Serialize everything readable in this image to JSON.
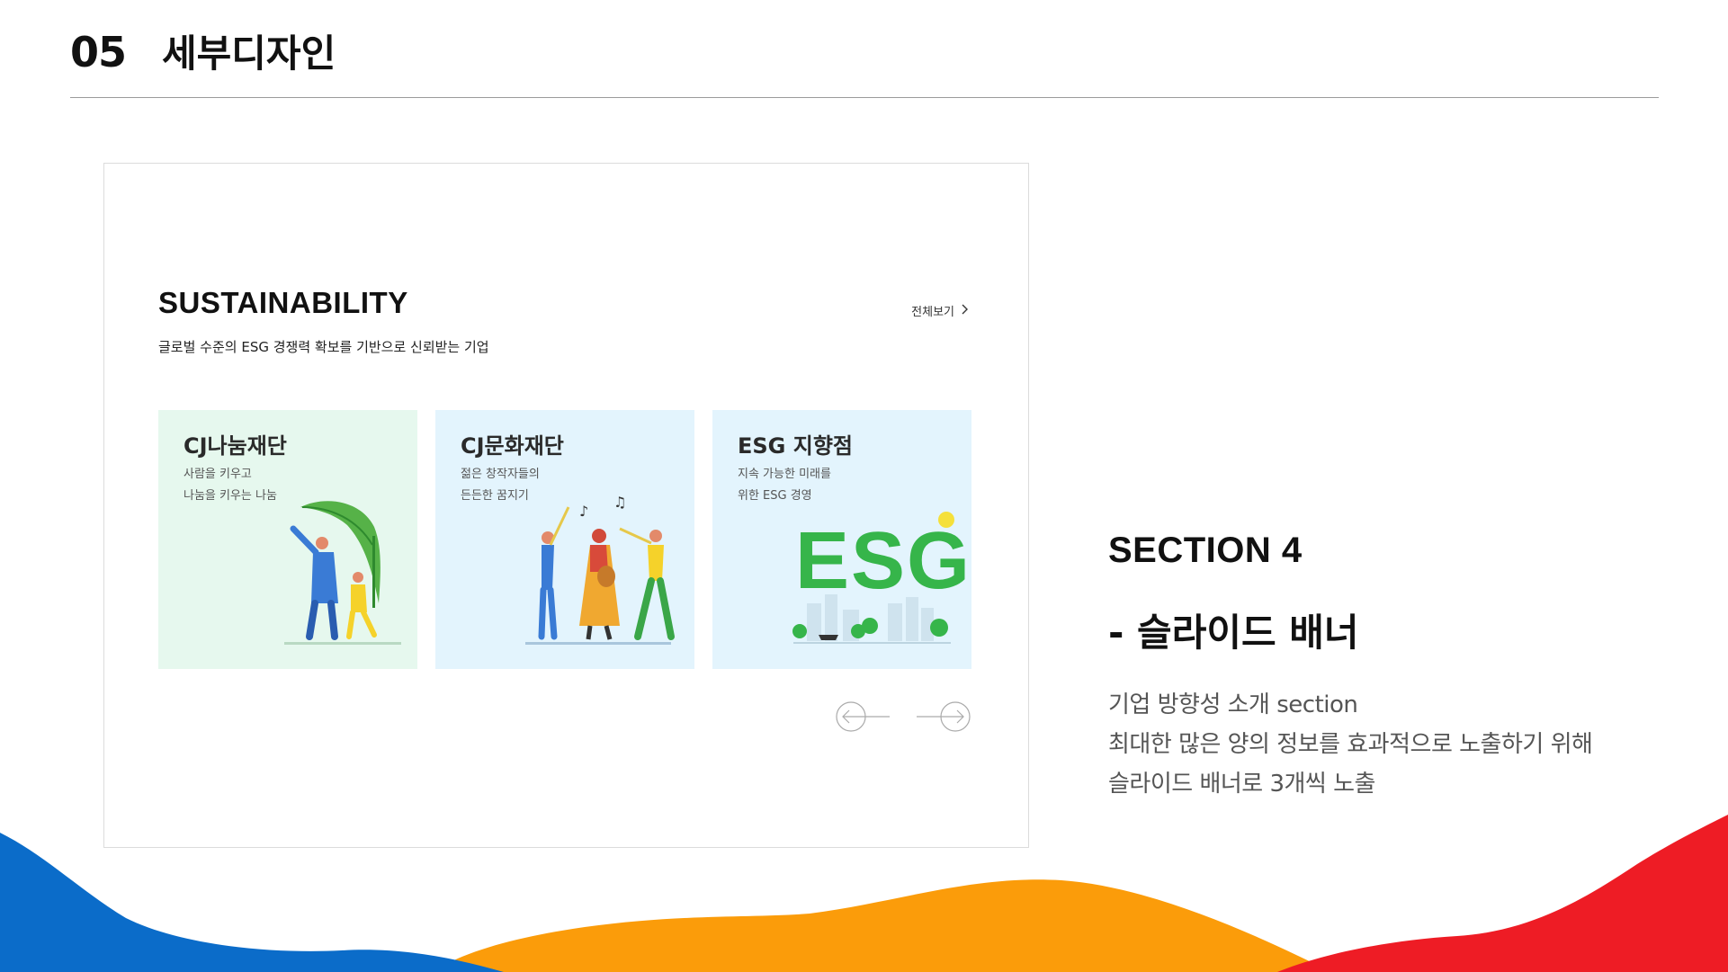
{
  "header": {
    "number": "05",
    "title": "세부디자인"
  },
  "mockup": {
    "title": "SUSTAINABILITY",
    "subtitle": "글로벌 수준의 ESG 경쟁력 확보를 기반으로 신뢰받는 기업",
    "see_all": "전체보기",
    "cards": [
      {
        "title": "CJ나눔재단",
        "desc1": "사람을 키우고",
        "desc2": "나눔을 키우는 나눔",
        "bg": "#e6f8ee"
      },
      {
        "title": "CJ문화재단",
        "desc1": "젊은 창작자들의",
        "desc2": "든든한 꿈지기",
        "bg": "#e3f4fd"
      },
      {
        "title": "ESG 지향점",
        "desc1": "지속 가능한 미래를",
        "desc2": "위한 ESG 경영",
        "bg": "#e3f4fd"
      }
    ],
    "esg_logo_text": "ESG"
  },
  "section": {
    "title": "SECTION 4",
    "subtitle": "- 슬라이드 배너",
    "desc": [
      "기업 방향성 소개 section",
      "최대한 많은 양의 정보를 효과적으로 노출하기 위해",
      "슬라이드 배너로 3개씩 노출"
    ]
  },
  "colors": {
    "wave_blue": "#0b6cc9",
    "wave_orange": "#fb9c0a",
    "wave_red": "#ee1c25",
    "card_green": "#e6f8ee",
    "card_blue": "#e3f4fd"
  },
  "icons": {
    "see_all": "chevron-right-icon",
    "prev": "arrow-left-circle-icon",
    "next": "arrow-right-circle-icon"
  }
}
